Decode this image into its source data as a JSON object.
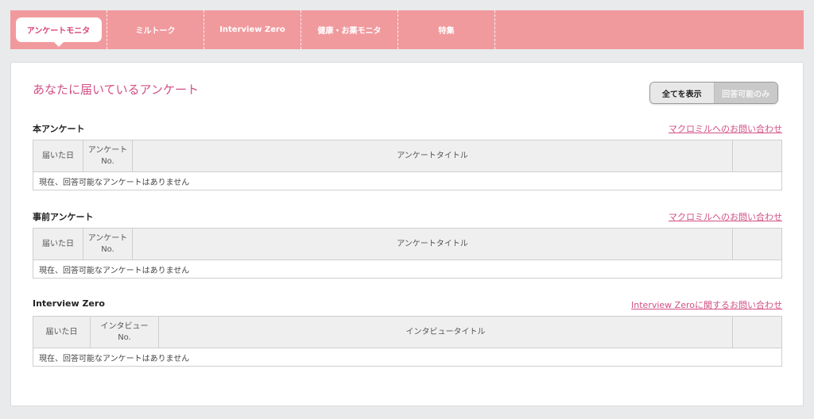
{
  "nav": {
    "items": [
      {
        "label": "アンケートモニタ",
        "active": true
      },
      {
        "label": "ミルトーク",
        "active": false
      },
      {
        "label": "Interview Zero",
        "active": false
      },
      {
        "label": "健康・お薬モニタ",
        "active": false
      },
      {
        "label": "特集",
        "active": false
      }
    ]
  },
  "page": {
    "title": "あなたに届いているアンケート",
    "toggle": {
      "all": "全てを表示",
      "answerable": "回答可能のみ"
    }
  },
  "sections": [
    {
      "title": "本アンケート",
      "link": "マクロミルへのお問い合わせ",
      "columns": {
        "date": "届いた日",
        "no_line1": "アンケート",
        "no_line2": "No.",
        "title": "アンケートタイトル",
        "extra": ""
      },
      "empty": "現在、回答可能なアンケートはありません"
    },
    {
      "title": "事前アンケート",
      "link": "マクロミルへのお問い合わせ",
      "columns": {
        "date": "届いた日",
        "no_line1": "アンケート",
        "no_line2": "No.",
        "title": "アンケートタイトル",
        "extra": ""
      },
      "empty": "現在、回答可能なアンケートはありません"
    },
    {
      "title": "Interview Zero",
      "link": "Interview Zeroに関するお問い合わせ",
      "columns": {
        "date": "届いた日",
        "no_line1": "インタビュー",
        "no_line2": "No.",
        "title": "インタビュータイトル",
        "extra": ""
      },
      "empty": "現在、回答可能なアンケートはありません"
    }
  ],
  "colors": {
    "nav_bg": "#f19a9e",
    "accent": "#d24f84"
  }
}
